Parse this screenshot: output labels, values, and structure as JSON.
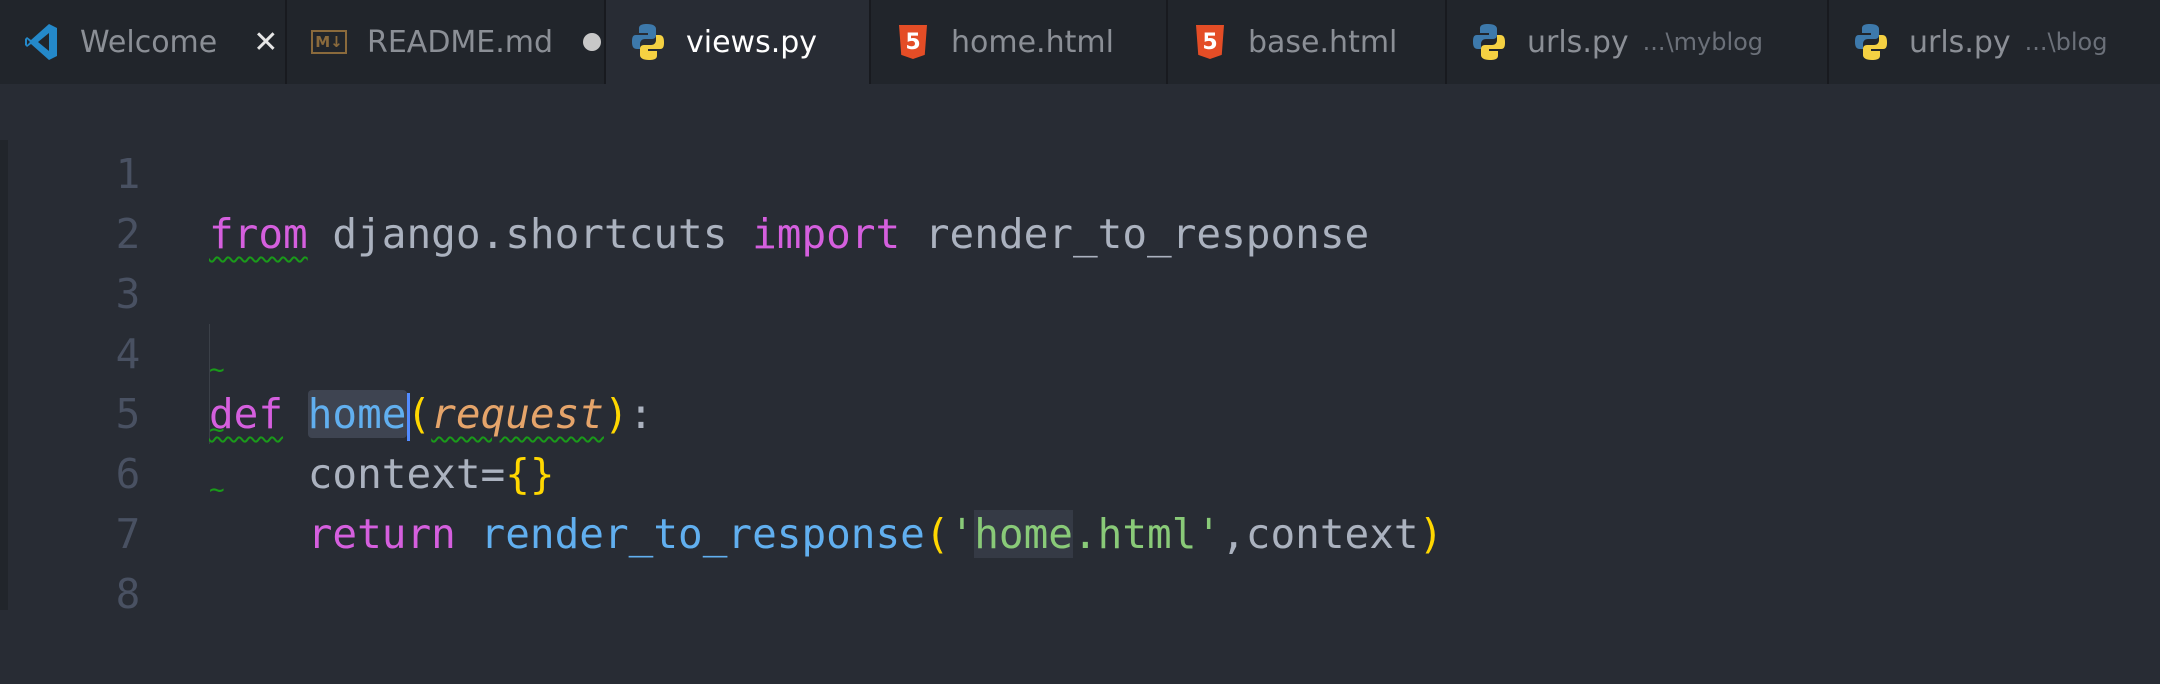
{
  "tabs": [
    {
      "label": "Welcome",
      "icon": "vscode-icon",
      "state": "close"
    },
    {
      "label": "README.md",
      "icon": "markdown-icon",
      "state": "unsaved"
    },
    {
      "label": "views.py",
      "icon": "python-icon",
      "state": "active"
    },
    {
      "label": "home.html",
      "icon": "html5-icon"
    },
    {
      "label": "base.html",
      "icon": "html5-icon"
    },
    {
      "label": "urls.py",
      "icon": "python-icon",
      "desc": "...\\myblog"
    },
    {
      "label": "urls.py",
      "icon": "python-icon",
      "desc": "...\\blog"
    }
  ],
  "close_glyph": "✕",
  "markdown_badge": "M↓",
  "html5_badge": "5",
  "line_numbers": [
    "1",
    "2",
    "3",
    "4",
    "5",
    "6",
    "7",
    "8"
  ],
  "code": {
    "l1": {
      "from": "from",
      "mod": " django.shortcuts ",
      "import": "import",
      "name": " render_to_response"
    },
    "l4": {
      "def": "def",
      "sp": " ",
      "fn": "home",
      "lp": "(",
      "param": "request",
      "rp": ")",
      "colon": ":"
    },
    "l5": {
      "indent": "    ",
      "var": "context",
      "eq": "=",
      "braces": "{}"
    },
    "l6": {
      "indent": "    ",
      "ret": "return",
      "sp": " ",
      "fn": "render_to_response",
      "lp": "(",
      "q1": "'",
      "s1": "home",
      "s2": ".html",
      "q2": "'",
      "comma": ",",
      "arg": "context",
      "rp": ")"
    }
  },
  "tilde": "~",
  "colors": {
    "keyword": "#d55fde",
    "function": "#61afef",
    "parameter": "#e5a46a",
    "string": "#89ca78",
    "bracket": "#ffd700",
    "text": "#abb2bf",
    "background": "#282c34"
  }
}
